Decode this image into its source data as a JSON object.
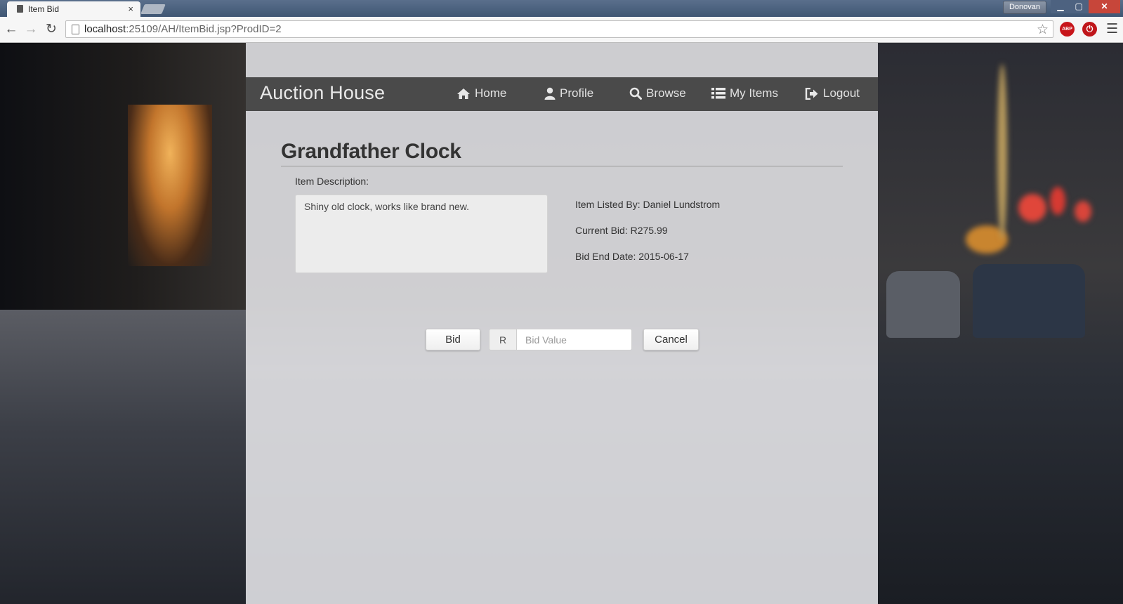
{
  "browser": {
    "tab_title": "Item Bid",
    "tab_close": "×",
    "profile_name": "Donovan",
    "url_host": "localhost",
    "url_rest": ":25109/AH/ItemBid.jsp?ProdID=2",
    "ext_abp": "ABP"
  },
  "nav": {
    "brand": "Auction House",
    "items": [
      {
        "label": "Home",
        "icon": "home-icon"
      },
      {
        "label": "Profile",
        "icon": "user-icon"
      },
      {
        "label": "Browse",
        "icon": "search-icon"
      },
      {
        "label": "My Items",
        "icon": "list-icon"
      },
      {
        "label": "Logout",
        "icon": "logout-icon"
      }
    ]
  },
  "item": {
    "title": "Grandfather Clock",
    "description_label": "Item Description:",
    "description": "Shiny old clock, works like brand new.",
    "listed_by": "Item Listed By: Daniel Lundstrom",
    "current_bid": "Current Bid: R275.99",
    "end_date": "Bid End Date: 2015-06-17"
  },
  "bid_form": {
    "bid_label": "Bid",
    "currency": "R",
    "placeholder": "Bid Value",
    "value": "",
    "cancel_label": "Cancel"
  }
}
